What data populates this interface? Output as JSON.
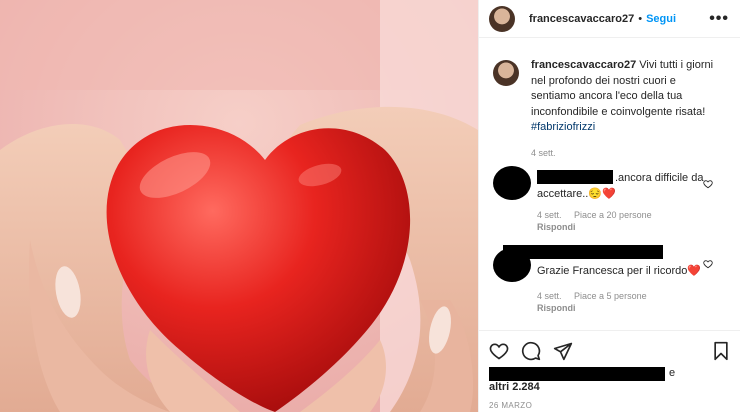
{
  "header": {
    "username": "francescavaccaro27",
    "separator": "•",
    "follow_label": "Segui",
    "more_label": "•••"
  },
  "caption": {
    "username": "francescavaccaro27",
    "text": "Vivi tutti i giorni nel profondo dei nostri cuori e sentiamo ancora l'eco della tua inconfondibile e coinvolgente risata!",
    "hashtag": "#fabriziofrizzi",
    "time": "4 sett."
  },
  "comments": [
    {
      "text": ".ancora difficile da accettare..😔❤️",
      "time": "4 sett.",
      "likes": "Piace a 20 persone",
      "reply": "Rispondi"
    },
    {
      "text": "Grazie Francesca per il ricordo❤️",
      "time": "4 sett.",
      "likes": "Piace a 5 persone",
      "reply": "Rispondi"
    }
  ],
  "likes": {
    "suffix": "e",
    "others": "altri 2.284"
  },
  "date": "26 MARZO",
  "icons": {
    "like": "heart-icon",
    "comment": "comment-icon",
    "share": "share-icon",
    "save": "bookmark-icon"
  }
}
